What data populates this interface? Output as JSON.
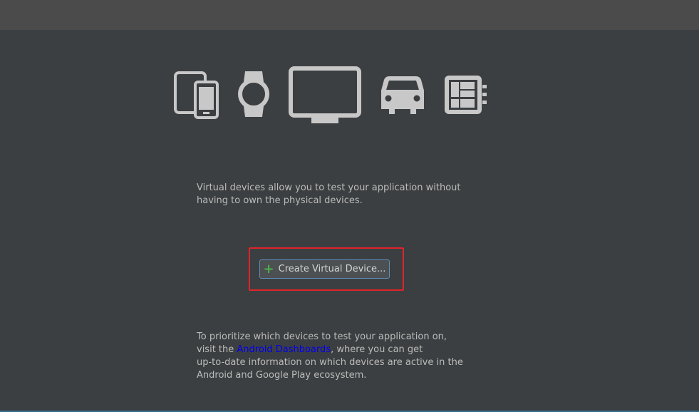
{
  "device_icons": [
    "phone-tablet-icon",
    "watch-icon",
    "tv-icon",
    "car-icon",
    "things-icon"
  ],
  "description": {
    "line1": "Virtual devices allow you to test your application without",
    "line2": "having to own the physical devices."
  },
  "create_button": {
    "icon": "+",
    "label": "Create Virtual Device..."
  },
  "info": {
    "line1": "To prioritize which devices to test your application on,",
    "line2_prefix": "visit the ",
    "link_label": "Android Dashboards",
    "line2_suffix": ", where you can get",
    "line3": "up-to-date information on which devices are active in the",
    "line4": "Android and Google Play ecosystem."
  },
  "colors": {
    "background": "#3c3f41",
    "topbar": "#4b4b4b",
    "icon": "#c8c8c8",
    "highlight": "#e0242a",
    "link": "#0000ee",
    "plus": "#4cae4c"
  }
}
